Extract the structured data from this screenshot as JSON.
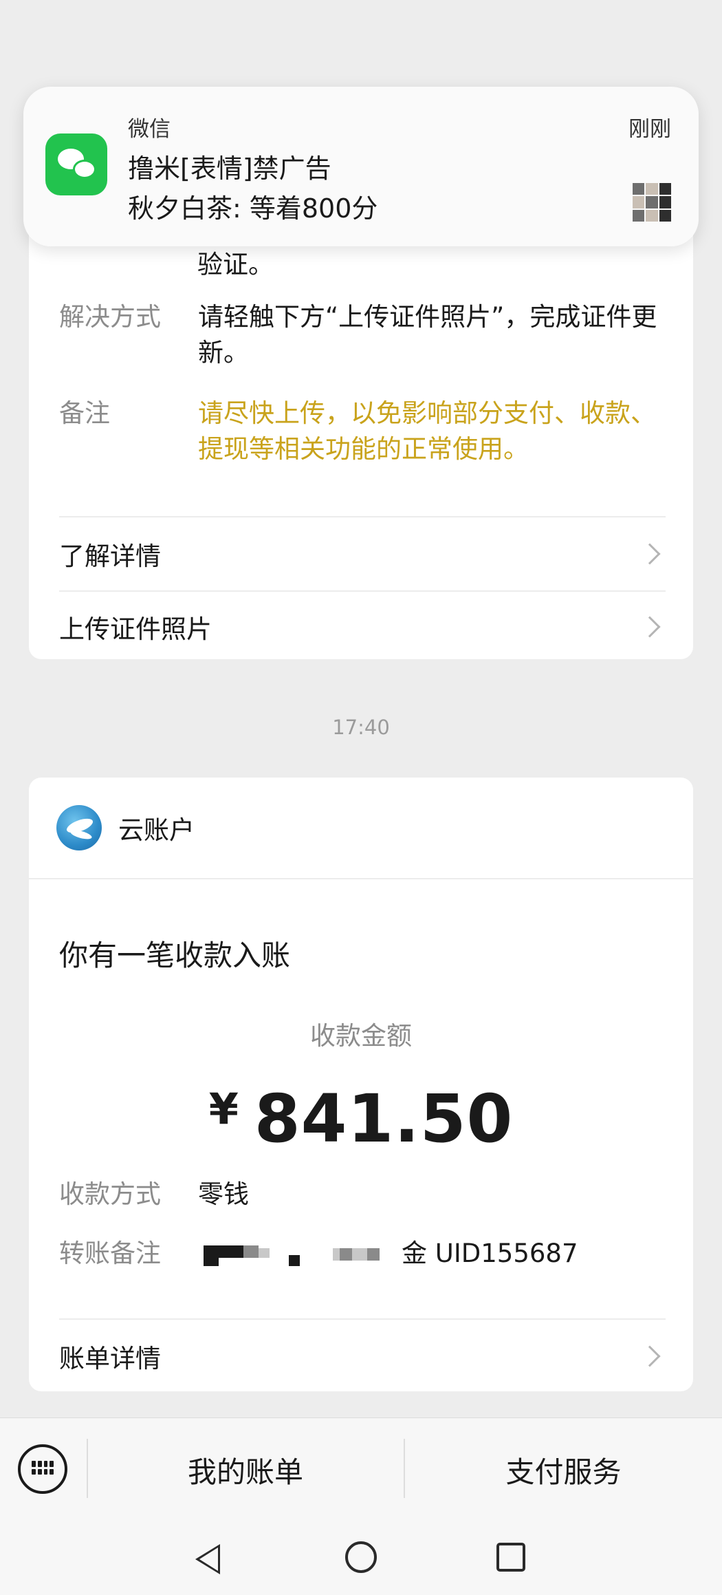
{
  "notification": {
    "app": "微信",
    "time": "刚刚",
    "title": "撸米[表情]禁广告",
    "body": "秋夕白茶: 等着800分",
    "icon": "wechat-icon"
  },
  "notice_card": {
    "verify_tail": "验证。",
    "rows": [
      {
        "label": "解决方式",
        "value": "请轻触下方“上传证件照片”，完成证件更新。"
      },
      {
        "label": "备注",
        "value": "请尽快上传，以免影响部分支付、收款、提现等相关功能的正常使用。",
        "color": "#c9a31c"
      }
    ],
    "links": [
      "了解详情",
      "上传证件照片"
    ]
  },
  "timestamp": "17:40",
  "payment_card": {
    "app_name": "云账户",
    "title": "你有一笔收款入账",
    "amount_label": "收款金额",
    "currency": "¥",
    "amount": "841.50",
    "method_label": "收款方式",
    "method_value": "零钱",
    "note_label": "转账备注",
    "note_visible": "金 UID155687",
    "link": "账单详情"
  },
  "bottom_menu": {
    "keyboard_icon": "keyboard-icon",
    "items": [
      "我的账单",
      "支付服务"
    ]
  },
  "nav": {
    "back": "back-icon",
    "home": "home-icon",
    "recent": "recent-apps-icon"
  }
}
